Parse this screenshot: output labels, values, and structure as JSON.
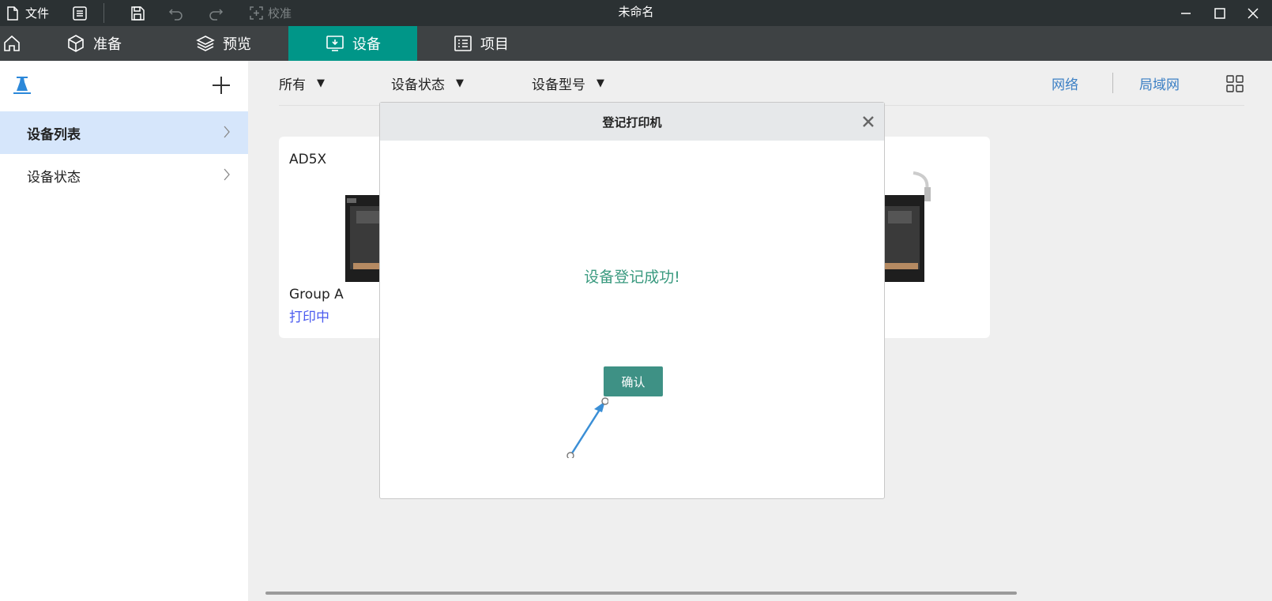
{
  "titlebar": {
    "file_label": "文件",
    "calibrate_label": "校准",
    "window_title": "未命名"
  },
  "tabs": [
    {
      "label": "准备"
    },
    {
      "label": "预览"
    },
    {
      "label": "设备"
    },
    {
      "label": "项目"
    }
  ],
  "active_tab": "设备",
  "sidebar": {
    "items": [
      {
        "label": "设备列表",
        "active": true
      },
      {
        "label": "设备状态",
        "active": false
      }
    ]
  },
  "filters": {
    "all": "所有",
    "status": "设备状态",
    "model": "设备型号"
  },
  "links": {
    "network": "网络",
    "lan": "局域网"
  },
  "devices": [
    {
      "name": "AD5X",
      "group": "Group A",
      "status": "打印中"
    }
  ],
  "dialog": {
    "title": "登记打印机",
    "message": "设备登记成功!",
    "ok_label": "确认"
  },
  "colors": {
    "accent": "#009688",
    "dialog_button": "#3e9185",
    "link": "#3b7fc4",
    "status_printing": "#4b5bef",
    "sidebar_active": "#d6e6fb"
  }
}
